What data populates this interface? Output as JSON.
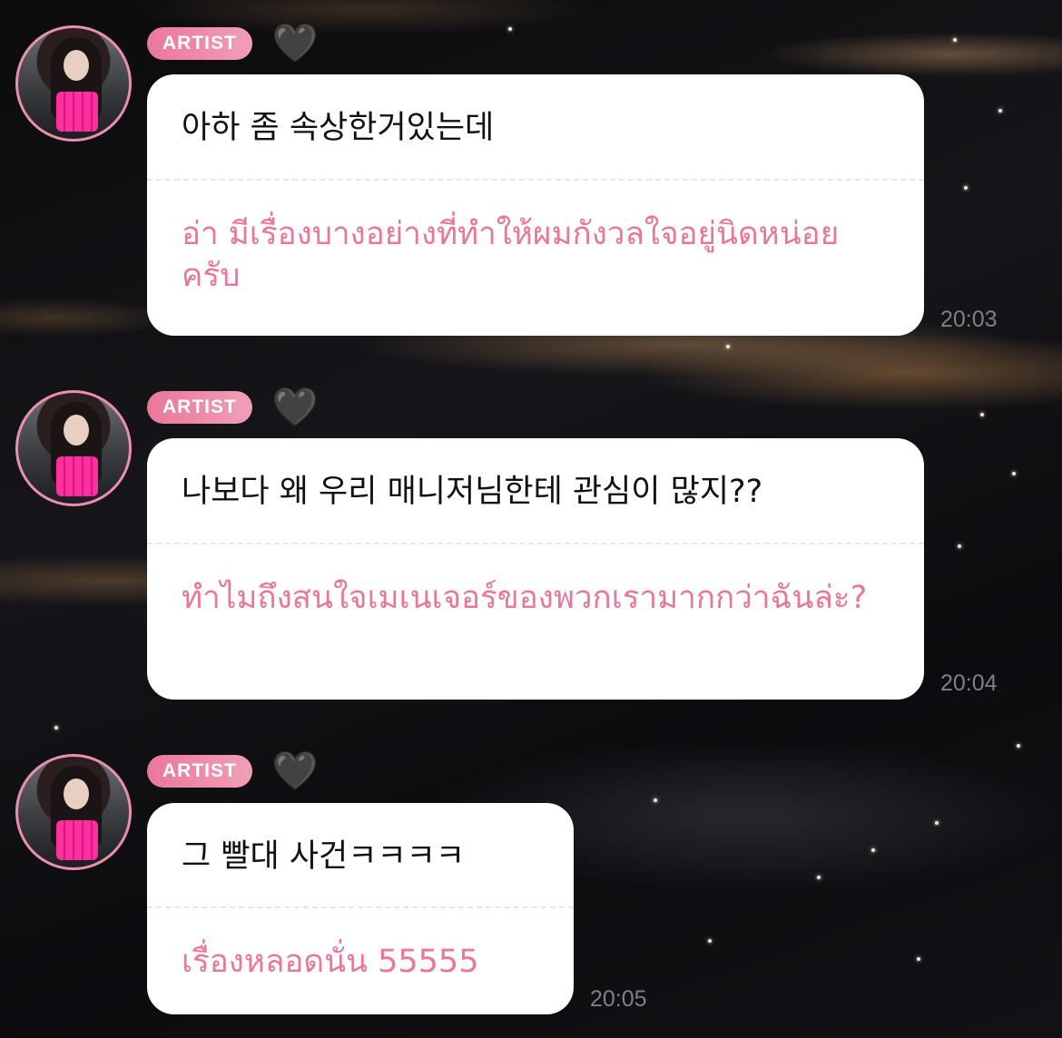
{
  "messages": [
    {
      "badge": "ARTIST",
      "heart_icon": "black-heart-icon",
      "original": "아하 좀 속상한거있는데",
      "translation": "อ่า มีเรื่องบางอย่างที่ทำให้ผมกังวลใจอยู่นิดหน่อยครับ",
      "time": "20:03"
    },
    {
      "badge": "ARTIST",
      "heart_icon": "black-heart-icon",
      "original": "나보다 왜 우리 매니저님한테 관심이 많지??",
      "translation": "ทำไมถึงสนใจเมเนเจอร์ของพวกเรามากกว่าฉันล่ะ?",
      "time": "20:04"
    },
    {
      "badge": "ARTIST",
      "heart_icon": "black-heart-icon",
      "original": "그 빨대 사건ㅋㅋㅋㅋ",
      "translation": "เรื่องหลอดนั่น 55555",
      "time": "20:05"
    }
  ],
  "colors": {
    "badge": "#ea7799",
    "translation_text": "#e97798",
    "avatar_ring": "#ec8fae",
    "bubble": "#ffffff"
  }
}
